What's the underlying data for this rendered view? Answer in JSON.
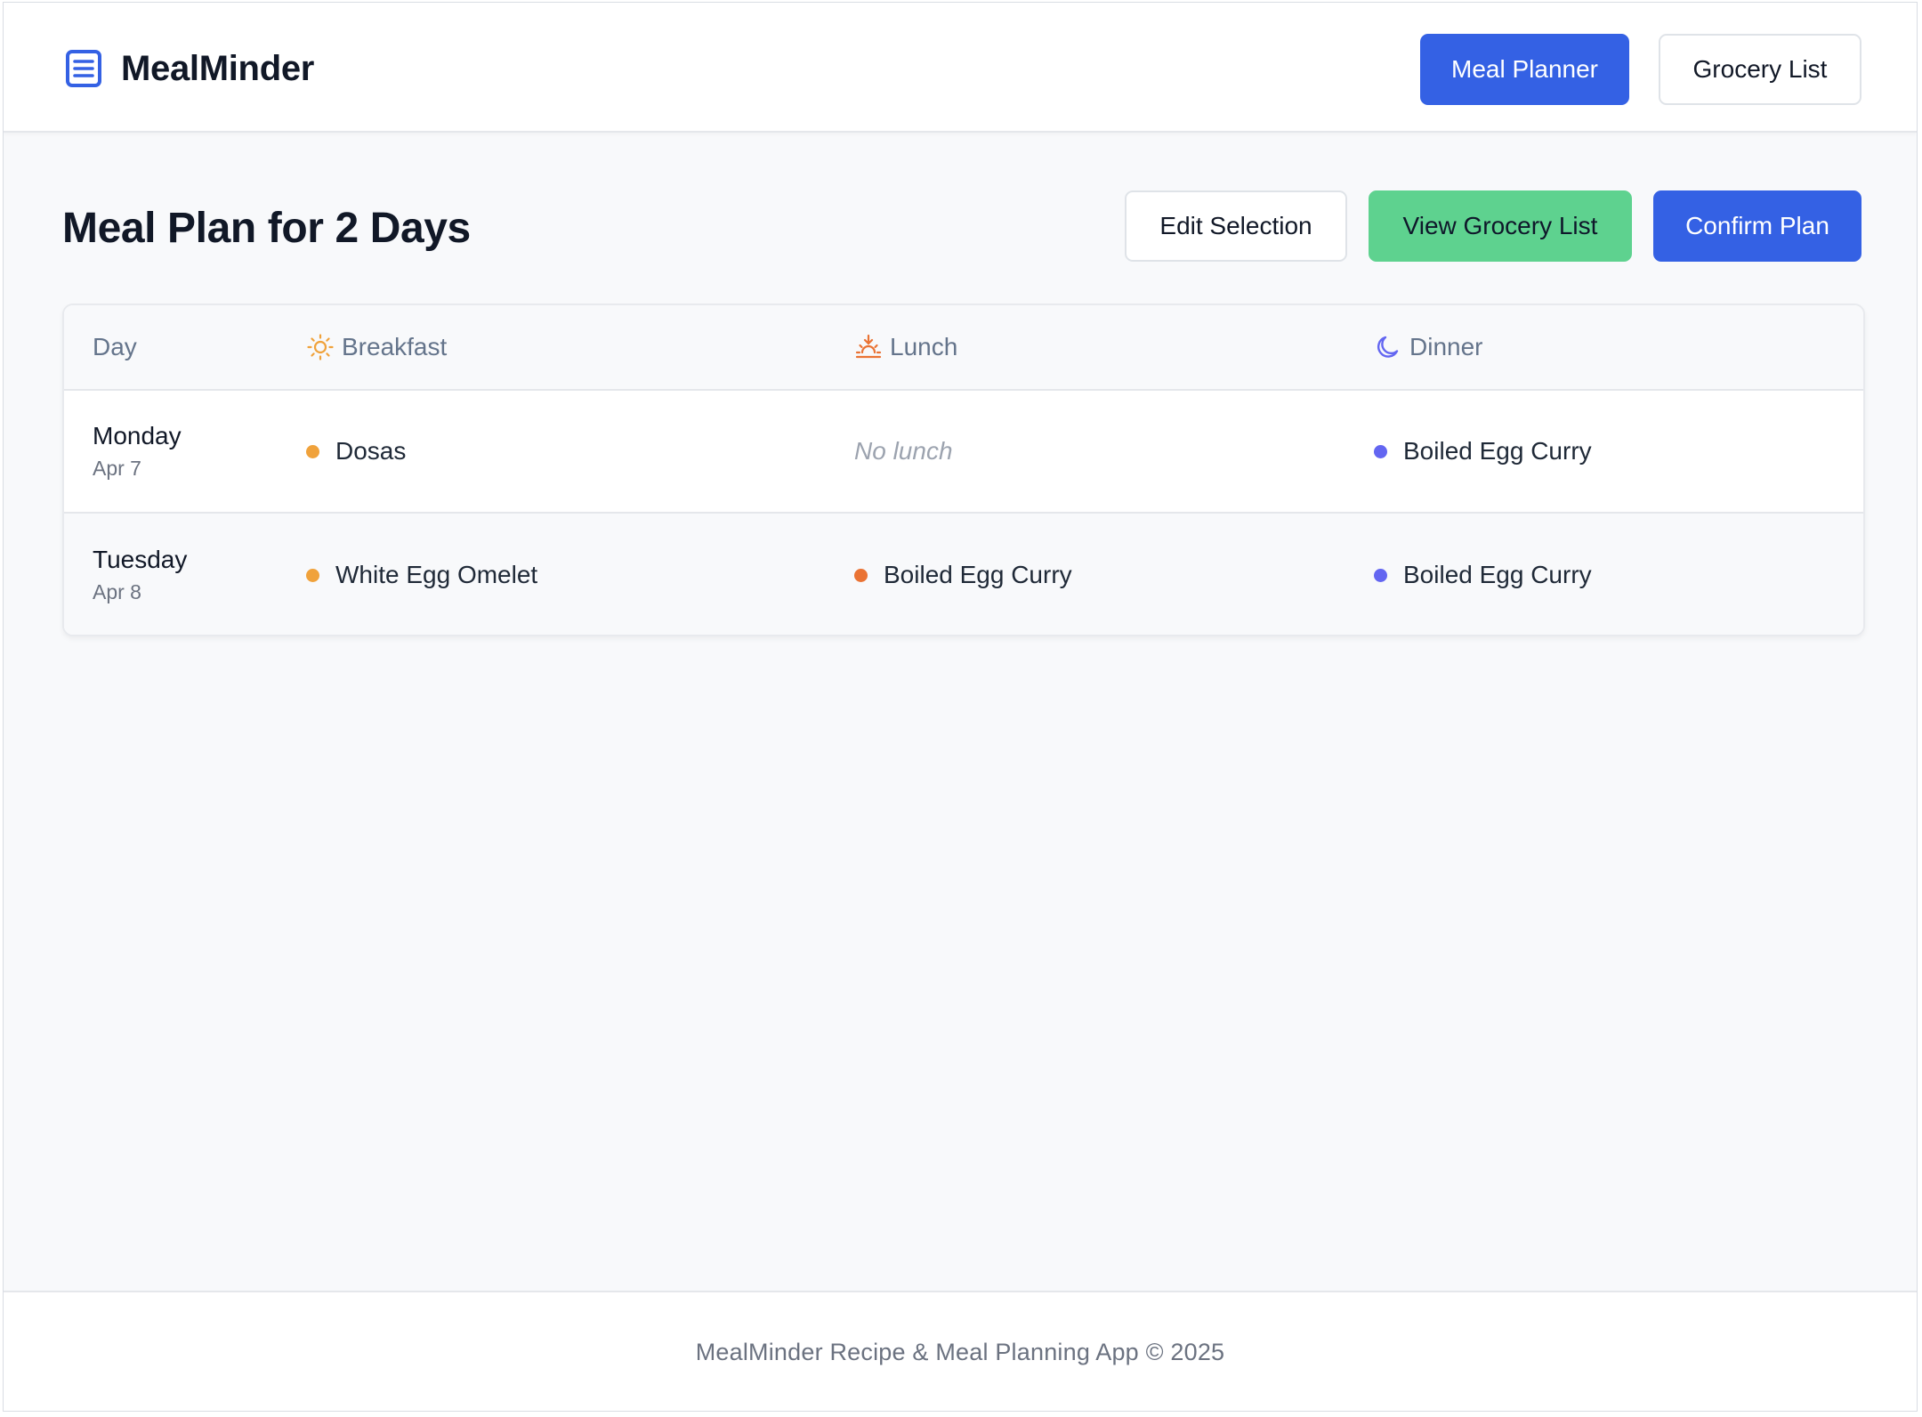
{
  "app": {
    "name": "MealMinder",
    "logo_icon": "list-document-icon",
    "accent_color": "#3461e4"
  },
  "nav": {
    "meal_planner_label": "Meal Planner",
    "grocery_list_label": "Grocery List",
    "active": "Meal Planner"
  },
  "page": {
    "title": "Meal Plan for 2 Days"
  },
  "actions": {
    "edit_label": "Edit Selection",
    "view_grocery_label": "View Grocery List",
    "confirm_label": "Confirm Plan"
  },
  "table": {
    "headers": {
      "day": "Day",
      "breakfast": "Breakfast",
      "lunch": "Lunch",
      "dinner": "Dinner"
    },
    "header_icons": {
      "breakfast": "sun-icon",
      "lunch": "sunset-icon",
      "dinner": "moon-icon"
    },
    "meal_colors": {
      "breakfast": "#f0a23b",
      "lunch": "#ea7334",
      "dinner": "#6366f1"
    },
    "rows": [
      {
        "day": "Monday",
        "date": "Apr 7",
        "breakfast": "Dosas",
        "lunch": "",
        "lunch_empty": "No lunch",
        "dinner": "Boiled Egg Curry"
      },
      {
        "day": "Tuesday",
        "date": "Apr 8",
        "breakfast": "White Egg Omelet",
        "lunch": "Boiled Egg Curry",
        "dinner": "Boiled Egg Curry"
      }
    ]
  },
  "footer": {
    "text": "MealMinder Recipe & Meal Planning App © 2025"
  }
}
